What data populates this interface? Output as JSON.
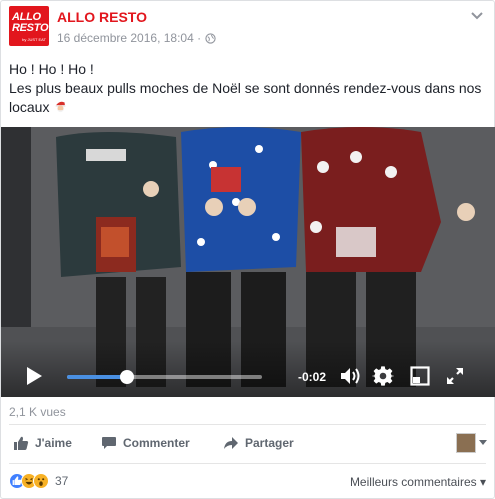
{
  "page": {
    "name": "ALLO RESTO",
    "logo_line1": "ALLO",
    "logo_line2": "RESTO",
    "logo_line3": "by JUST EAT",
    "timestamp": "16 décembre 2016, 18:04 ·",
    "privacy_icon": "globe-icon",
    "brand_color": "#e2161d"
  },
  "post": {
    "line1": "Ho ! Ho ! Ho !",
    "line2": "Les plus beaux pulls moches de Noël se sont donnés rendez-vous dans nos locaux",
    "emoji": "santa-emoji"
  },
  "video": {
    "time_remaining": "-0:02",
    "progress": 0.31,
    "accent": "#4a90e2",
    "icons": [
      "play-icon",
      "volume-icon",
      "settings-icon",
      "pip-icon",
      "fullscreen-icon"
    ]
  },
  "stats": {
    "views": "2,1 K vues"
  },
  "actions": {
    "like": "J'aime",
    "comment": "Commenter",
    "share": "Partager"
  },
  "reactions": {
    "count": "37",
    "types": [
      "like",
      "haha",
      "wow"
    ]
  },
  "comments": {
    "sort_label": "Meilleurs commentaires ▾"
  }
}
